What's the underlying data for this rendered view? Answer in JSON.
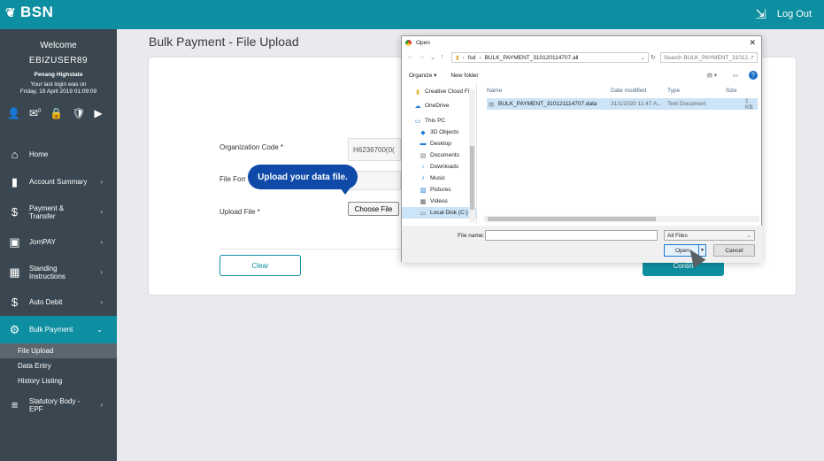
{
  "brand": {
    "logo": "BSN"
  },
  "topbar": {
    "logout": "Log Out"
  },
  "user": {
    "welcome": "Welcome",
    "username": "EBIZUSER89",
    "branch": "Penang Highstate",
    "last_login_label": "Your last login was on",
    "last_login_time": "Friday, 19 April 2019 01:09:09",
    "mail_count": "0"
  },
  "menu": {
    "home": "Home",
    "account": "Account Summary",
    "payment": "Payment &",
    "payment2": "Transfer",
    "jompay": "JomPAY",
    "standing": "Standing",
    "standing2": "Instructions",
    "auto": "Auto Debit",
    "bulk": "Bulk Payment",
    "sub_upload": "File Upload",
    "sub_entry": "Data Entry",
    "sub_history": "History Listing",
    "statutory": "Statutory Body -",
    "statutory2": "EPF"
  },
  "page": {
    "title": "Bulk Payment - File Upload",
    "org_label": "Organization Code *",
    "org_value": "H6236700(0(",
    "format_label": "File Forr",
    "upload_label": "Upload File *",
    "choose_btn": "Choose File",
    "clear_btn": "Clear",
    "continue_btn": "Contin",
    "tooltip": "Upload your data file."
  },
  "dialog": {
    "title": "Open",
    "path_root": "fsd",
    "path_folder": "BULK_PAYMENT_310120114707.all",
    "search_placeholder": "Search BULK_PAYMENT_31012...",
    "organize": "Organize ▾",
    "new_folder": "New folder",
    "nav": [
      "Creative Cloud File",
      "OneDrive",
      "This PC",
      "3D Objects",
      "Desktop",
      "Documents",
      "Downloads",
      "Music",
      "Pictures",
      "Videos",
      "Local Disk (C:)"
    ],
    "columns": {
      "name": "Name",
      "date": "Date modified",
      "type": "Type",
      "size": "Size"
    },
    "file": {
      "name": "BULK_PAYMENT_310121114707.data",
      "date": "31/1/2020 11:47 A...",
      "type": "Text Document",
      "size": "1 KB"
    },
    "filename_label": "File name:",
    "filter": "All Files",
    "open_btn": "Open",
    "cancel_btn": "Cancel"
  }
}
